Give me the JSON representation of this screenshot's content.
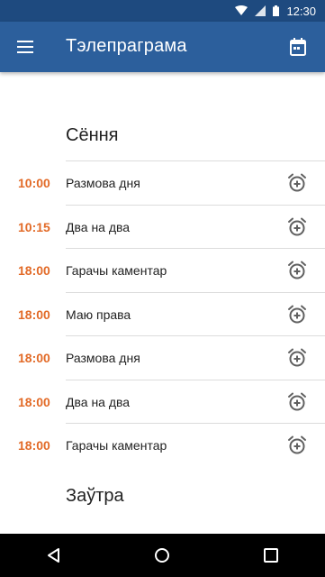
{
  "status_bar": {
    "time": "12:30"
  },
  "app_bar": {
    "title": "Тэлепраграма"
  },
  "today": {
    "title": "Сёння",
    "items": [
      {
        "time": "10:00",
        "name": "Размова дня"
      },
      {
        "time": "10:15",
        "name": "Два на два"
      },
      {
        "time": "18:00",
        "name": "Гарачы каментар"
      },
      {
        "time": "18:00",
        "name": "Маю права"
      },
      {
        "time": "18:00",
        "name": "Размова дня"
      },
      {
        "time": "18:00",
        "name": "Два на два"
      },
      {
        "time": "18:00",
        "name": "Гарачы каментар"
      }
    ]
  },
  "tomorrow": {
    "title": "Заўтра"
  },
  "colors": {
    "app_bar": "#2c5f9c",
    "status_bar": "#1e4a7f",
    "time_accent": "#e26a27"
  }
}
